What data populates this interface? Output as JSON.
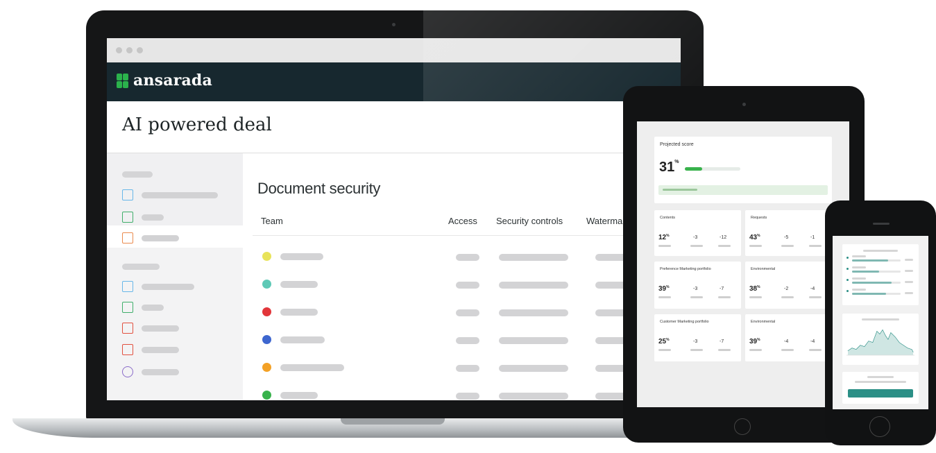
{
  "laptop": {
    "brand": "ansarada",
    "page_title": "AI powered deal",
    "section_title": "Document security",
    "table": {
      "columns": [
        "Team",
        "Access",
        "Security controls",
        "Waterma"
      ],
      "row_dot_colors": [
        "#e8e35a",
        "#5ec9b6",
        "#e2363a",
        "#3d66cf",
        "#f3a126",
        "#38b24c"
      ]
    },
    "sidebar_icon_colors": [
      "#67b7e9",
      "#3fae6a",
      "#ea8a4d",
      "#67b7e9",
      "#3fae6a",
      "#e2503f",
      "#e2503f",
      "#8a6bc9"
    ]
  },
  "tablet": {
    "projected_title": "Projected score",
    "projected_value": "31",
    "projected_unit": "%",
    "projected_progress": 0.31,
    "cards": [
      {
        "title": "Contents",
        "value": "12",
        "unit": "%",
        "a": "-3",
        "b": "-12"
      },
      {
        "title": "Requests",
        "value": "43",
        "unit": "%",
        "a": "-5",
        "b": "-1"
      },
      {
        "title": "Preference Marketing portfolio",
        "value": "39",
        "unit": "%",
        "a": "-3",
        "b": "-7"
      },
      {
        "title": "Environmental",
        "value": "38",
        "unit": "%",
        "a": "-2",
        "b": "-4"
      },
      {
        "title": "Customer Marketing portfolio",
        "value": "25",
        "unit": "%",
        "a": "-3",
        "b": "-7"
      },
      {
        "title": "Environmental",
        "value": "39",
        "unit": "%",
        "a": "-4",
        "b": "-4"
      }
    ]
  },
  "phone": {
    "bars": [
      0.74,
      0.56,
      0.82,
      0.7
    ],
    "accent": "#2b8f86"
  }
}
